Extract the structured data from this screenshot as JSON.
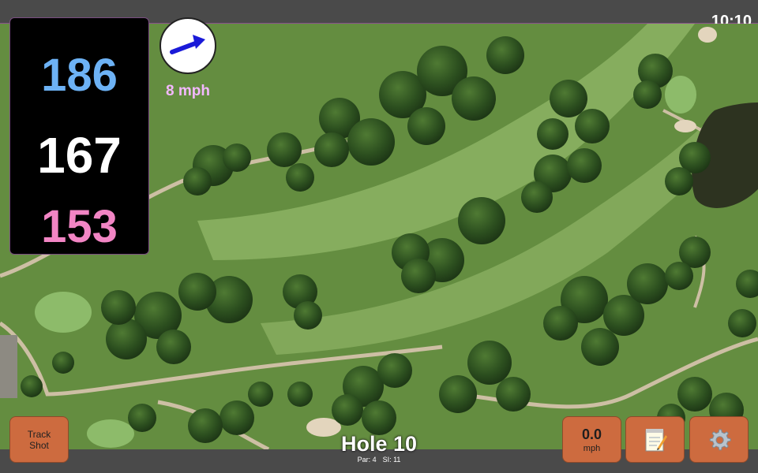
{
  "status": {
    "time": "10:10"
  },
  "yardages": {
    "back": "186",
    "center": "167",
    "front": "153",
    "colors": {
      "back": "#6db2f5",
      "center": "#ffffff",
      "front": "#f285c4"
    }
  },
  "wind": {
    "speed_label": "8 mph",
    "arrow_color": "#1a1ad8",
    "label_color": "#f3b8ff"
  },
  "hole": {
    "title": "Hole 10",
    "par": "Par: 4",
    "si": "SI: 11"
  },
  "buttons": {
    "track_shot_line1": "Track",
    "track_shot_line2": "Shot",
    "speed_value": "0.0",
    "speed_unit": "mph",
    "notes_icon": "notepad-icon",
    "settings_icon": "gear-icon"
  },
  "colors": {
    "button_bg": "#cd6b3f",
    "bar_bg": "#4a4a4a"
  }
}
